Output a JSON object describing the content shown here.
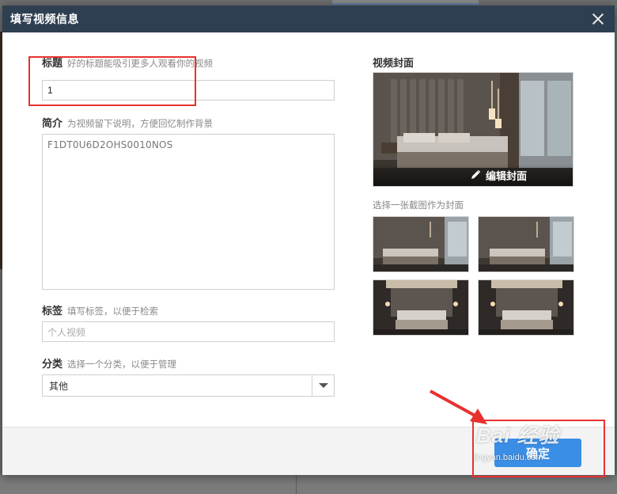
{
  "modal": {
    "title": "填写视频信息"
  },
  "form": {
    "title": {
      "label": "标题",
      "hint": "好的标题能吸引更多人观看你的视频",
      "value": "1"
    },
    "intro": {
      "label": "简介",
      "hint": "为视频留下说明，方便回忆制作背景",
      "value": "F1DT0U6D2OHS0010NOS"
    },
    "tags": {
      "label": "标签",
      "hint": "填写标签，以便于检索",
      "placeholder": "个人视频"
    },
    "category": {
      "label": "分类",
      "hint": "选择一个分类，以便于管理",
      "selected": "其他"
    }
  },
  "cover": {
    "title": "视频封面",
    "edit_label": "编辑封面",
    "hint": "选择一张截图作为封面",
    "thumbnails": [
      "thumb-1",
      "thumb-2",
      "thumb-3",
      "thumb-4"
    ]
  },
  "footer": {
    "confirm_label": "确定"
  },
  "watermark": {
    "main": "Bai 经验",
    "sub": "jingyan.baidu.com"
  },
  "icons": {
    "close": "close-icon",
    "edit": "pencil-icon",
    "dropdown": "chevron-down-icon"
  },
  "colors": {
    "header_bg": "#2f3f52",
    "button_bg": "#3a8ee6",
    "annotation": "#e8312f"
  }
}
